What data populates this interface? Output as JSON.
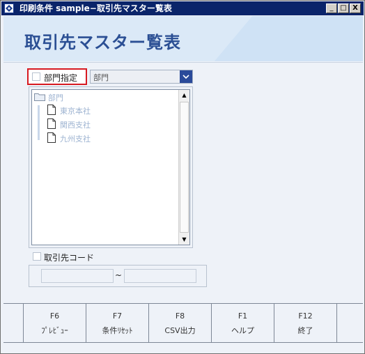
{
  "window": {
    "title": "印刷条件 sample−取引先マスター覧表",
    "minimize": "_",
    "maximize": "□",
    "close": "X"
  },
  "banner": {
    "title": "取引先マスター覧表"
  },
  "department": {
    "checkbox_label": "部門指定",
    "select_value": "部門",
    "tree": {
      "root": "部門",
      "children": [
        "東京本社",
        "関西支社",
        "九州支社"
      ]
    }
  },
  "partner_code": {
    "checkbox_label": "取引先コード",
    "range_separator": "~",
    "from_value": "",
    "to_value": ""
  },
  "function_keys": [
    {
      "key": "F6",
      "label": "ﾌﾟﾚﾋﾞｭｰ"
    },
    {
      "key": "F7",
      "label": "条件ﾘｾｯﾄ"
    },
    {
      "key": "F8",
      "label": "CSV出力"
    },
    {
      "key": "F1",
      "label": "ヘルプ"
    },
    {
      "key": "F12",
      "label": "終了"
    },
    {
      "key": "",
      "label": ""
    }
  ],
  "colors": {
    "titlebar": "#0a246a",
    "banner_text": "#2b4f94",
    "highlight_border": "#d71920",
    "tree_text": "#9db3d1"
  }
}
